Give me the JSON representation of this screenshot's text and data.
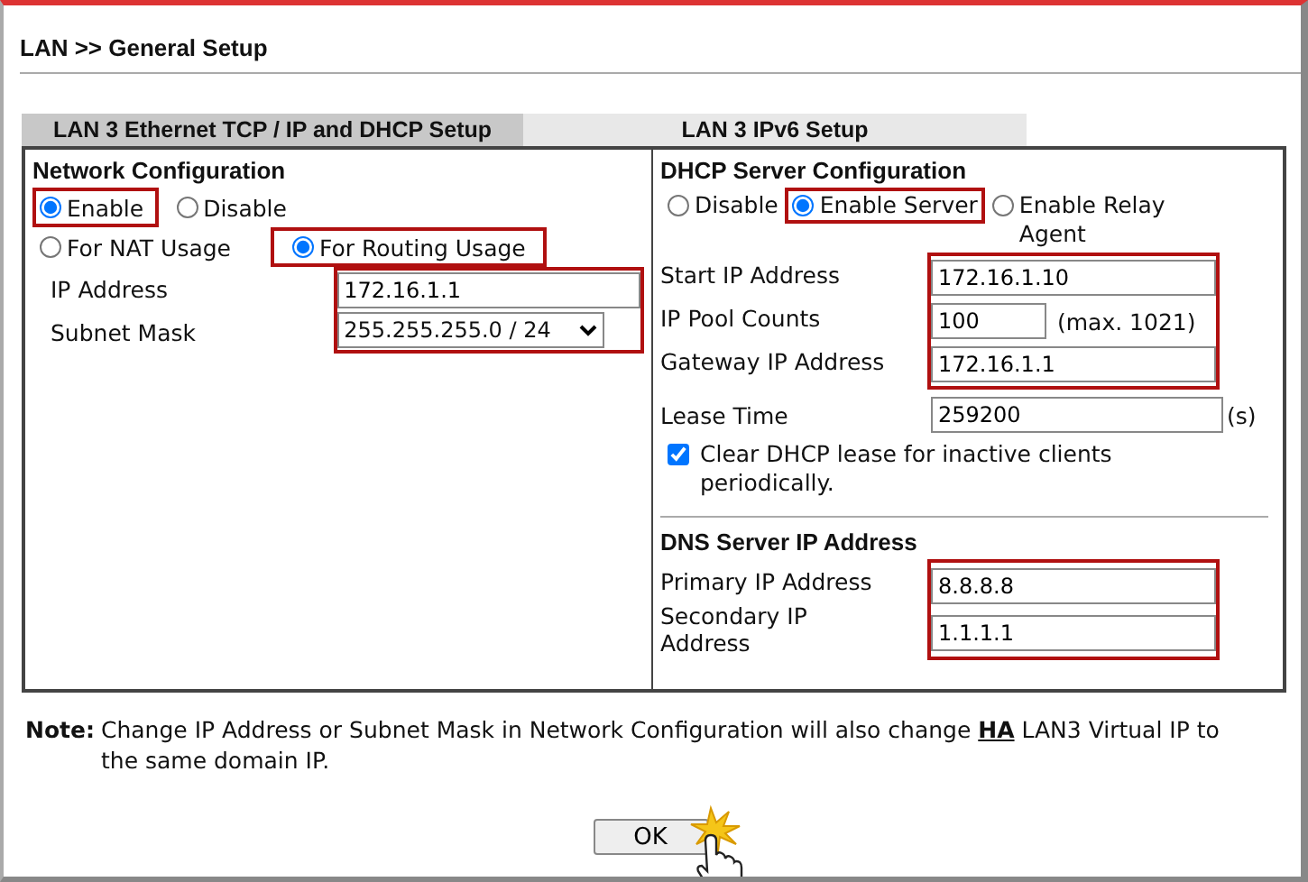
{
  "page_title": "LAN >> General Setup",
  "tabs": [
    {
      "label": "LAN 3 Ethernet TCP / IP and DHCP Setup",
      "selected": true
    },
    {
      "label": "LAN 3 IPv6 Setup",
      "selected": false
    }
  ],
  "network_configuration": {
    "heading": "Network Configuration",
    "status_options": [
      {
        "label": "Enable",
        "selected": true,
        "highlighted": true
      },
      {
        "label": "Disable",
        "selected": false,
        "highlighted": false
      }
    ],
    "usage_options": [
      {
        "label": "For NAT Usage",
        "selected": false,
        "highlighted": false
      },
      {
        "label": "For Routing Usage",
        "selected": true,
        "highlighted": true
      }
    ],
    "fields_highlighted": true,
    "fields": [
      {
        "label": "IP Address",
        "kind": "text",
        "value": "172.16.1.1"
      },
      {
        "label": "Subnet Mask",
        "kind": "select",
        "value": "255.255.255.0 / 24"
      }
    ]
  },
  "dhcp_server": {
    "heading": "DHCP Server Configuration",
    "options": [
      {
        "label": "Disable",
        "selected": false,
        "highlighted": false
      },
      {
        "label": "Enable Server",
        "selected": true,
        "highlighted": true
      },
      {
        "label": "Enable Relay Agent",
        "selected": false,
        "highlighted": false
      }
    ],
    "fields_highlighted": true,
    "fields": [
      {
        "label": "Start IP Address",
        "value": "172.16.1.10"
      },
      {
        "label": "IP Pool Counts",
        "value": "100",
        "suffix": "(max. 1021)"
      },
      {
        "label": "Gateway IP Address",
        "value": "172.16.1.1"
      }
    ],
    "lease_time": {
      "label": "Lease Time",
      "value": "259200",
      "suffix": "(s)"
    },
    "clear_lease": {
      "label": "Clear DHCP lease for inactive clients periodically.",
      "checked": true
    }
  },
  "dns_server": {
    "heading": "DNS Server IP Address",
    "fields_highlighted": true,
    "fields": [
      {
        "label": "Primary IP Address",
        "value": "8.8.8.8"
      },
      {
        "label": "Secondary IP Address",
        "value": "1.1.1.1"
      }
    ]
  },
  "note": {
    "label": "Note:",
    "text_before": "Change IP Address or Subnet Mask in Network Configuration will also change",
    "link": "HA",
    "text_after": "LAN3 Virtual IP to the same domain IP."
  },
  "ok_button": "OK"
}
